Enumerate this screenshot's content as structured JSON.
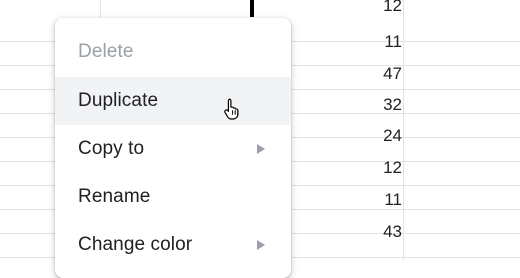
{
  "sheet": {
    "column_values": [
      "12",
      "11",
      "47",
      "32",
      "24",
      "12",
      "11",
      "43"
    ]
  },
  "context_menu": {
    "items": [
      {
        "label": "Delete",
        "state": "disabled"
      },
      {
        "label": "Duplicate",
        "state": "hovered"
      },
      {
        "label": "Copy to",
        "has_submenu": true
      },
      {
        "label": "Rename"
      },
      {
        "label": "Change color",
        "has_submenu": true
      }
    ]
  },
  "icons": {
    "cursor": "hand-pointer-icon",
    "submenu": "chevron-right-icon"
  }
}
